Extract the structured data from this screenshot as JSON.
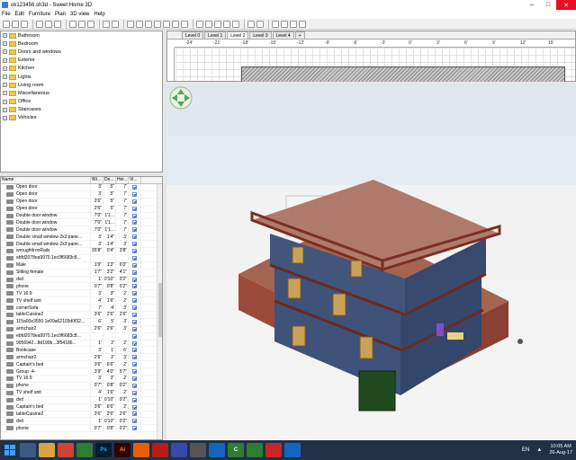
{
  "window": {
    "title": "ok123456.sh3d - Sweet Home 3D",
    "minimize": "–",
    "maximize": "□",
    "close": "✕"
  },
  "menu": [
    "File",
    "Edit",
    "Furniture",
    "Plan",
    "3D view",
    "Help"
  ],
  "catalog": {
    "categories": [
      "Bathroom",
      "Bedroom",
      "Doors and windows",
      "Exterior",
      "Kitchen",
      "Lights",
      "Living room",
      "Miscellaneous",
      "Office",
      "Staircases",
      "Vehicles"
    ]
  },
  "furniture": {
    "columns": [
      "Name",
      "Wi...",
      "De...",
      "Hei...",
      "Vi..."
    ],
    "rows": [
      {
        "name": "Open door",
        "w": "3'",
        "d": "5\"",
        "h": "7'"
      },
      {
        "name": "Open door",
        "w": "3'",
        "d": "5\"",
        "h": "7'"
      },
      {
        "name": "Open door",
        "w": "2'6\"",
        "d": "5\"",
        "h": "7'"
      },
      {
        "name": "Open door",
        "w": "2'6\"",
        "d": "5\"",
        "h": "7'"
      },
      {
        "name": "Double door window",
        "w": "7'0\"",
        "d": "1'1...",
        "h": "7'"
      },
      {
        "name": "Double door window",
        "w": "7'0\"",
        "d": "1'1...",
        "h": "7'"
      },
      {
        "name": "Double door window",
        "w": "7'0\"",
        "d": "1'1...",
        "h": "7'"
      },
      {
        "name": "Double small window 2x3 pane...",
        "w": "3'",
        "d": "1'4\"",
        "h": "3'"
      },
      {
        "name": "Double small window 2x3 pane...",
        "w": "3'",
        "d": "1'4\"",
        "h": "3'"
      },
      {
        "name": "wroughtIronRails",
        "w": "35'8\"",
        "d": "0'4\"",
        "h": "3'8\""
      },
      {
        "name": "ebfd2078ea9970.1ec0f6683c8...",
        "w": "",
        "d": "",
        "h": ""
      },
      {
        "name": "Male",
        "w": "1'9\"",
        "d": "1'3\"",
        "h": "6'0\""
      },
      {
        "name": "Sitting female",
        "w": "1'7\"",
        "d": "3'2\"",
        "h": "4'1\""
      },
      {
        "name": "dvd",
        "w": "1'",
        "d": "0'10\"",
        "h": "0'2\""
      },
      {
        "name": "phone",
        "w": "0'7\"",
        "d": "0'8\"",
        "h": "0'2\""
      },
      {
        "name": "TV 16:9",
        "w": "3'",
        "d": "3\"",
        "h": "2'"
      },
      {
        "name": "TV shelf unit",
        "w": "4'",
        "d": "1'6\"",
        "h": "2'"
      },
      {
        "name": "cornerSofa",
        "w": "7'",
        "d": "4'",
        "h": "3'"
      },
      {
        "name": "tableCuisine2",
        "w": "3'6\"",
        "d": "2'6\"",
        "h": "2'6\""
      },
      {
        "name": "115a00e3550.1e09a62103d0f32...",
        "w": "6'",
        "d": "5'",
        "h": "3'"
      },
      {
        "name": "armchair2",
        "w": "2'6\"",
        "d": "2'6\"",
        "h": "3'"
      },
      {
        "name": "ebfd2078ea9970.1ec0f6683c8...",
        "w": "",
        "d": "",
        "h": ""
      },
      {
        "name": "9056942...8d190b...3f54186...",
        "w": "1'",
        "d": "2'",
        "h": "2'"
      },
      {
        "name": "Bookcase",
        "w": "3'",
        "d": "1'",
        "h": "6'"
      },
      {
        "name": "armchair2",
        "w": "2'6\"",
        "d": "2'",
        "h": "3'"
      },
      {
        "name": "Captain's bed",
        "w": "3'6\"",
        "d": "6'6\"",
        "h": "2'"
      },
      {
        "name": "Group -4-",
        "w": "3'9\"",
        "d": "4'0\"",
        "h": "5'7\""
      },
      {
        "name": "TV 16:9",
        "w": "3'",
        "d": "3\"",
        "h": "2'"
      },
      {
        "name": "phone",
        "w": "0'7\"",
        "d": "0'8\"",
        "h": "0'2\""
      },
      {
        "name": "TV shelf unit",
        "w": "4'",
        "d": "1'6\"",
        "h": "2'"
      },
      {
        "name": "dvd",
        "w": "1'",
        "d": "0'10\"",
        "h": "0'2\""
      },
      {
        "name": "Captain's bed",
        "w": "3'6\"",
        "d": "6'6\"",
        "h": "2'"
      },
      {
        "name": "tableCuisine2",
        "w": "3'6\"",
        "d": "2'6\"",
        "h": "2'6\""
      },
      {
        "name": "dvd",
        "w": "1'",
        "d": "0'10\"",
        "h": "0'2\""
      },
      {
        "name": "phone",
        "w": "0'7\"",
        "d": "0'8\"",
        "h": "0'2\""
      }
    ]
  },
  "plan": {
    "tabs": [
      "Level 0",
      "Level 1",
      "Level 2",
      "Level 3",
      "Level 4",
      "+"
    ],
    "active_tab": 2,
    "ruler": [
      "-24'",
      "-21'",
      "-18'",
      "-15'",
      "-12'",
      "-9'",
      "-6'",
      "-3'",
      "0'",
      "3'",
      "6'",
      "9'",
      "12'",
      "15'",
      "18'"
    ]
  },
  "taskbar": {
    "chrome_label": "C",
    "ps_label": "Ps",
    "ai_label": "Ai",
    "lang": "EN",
    "time": "10:05 AM",
    "date": "26-Aug-17"
  },
  "colors": {
    "accent": "#1f3147",
    "wall": "#3f5277",
    "brick": "#9c4b3a",
    "railing": "#7a2f24"
  }
}
